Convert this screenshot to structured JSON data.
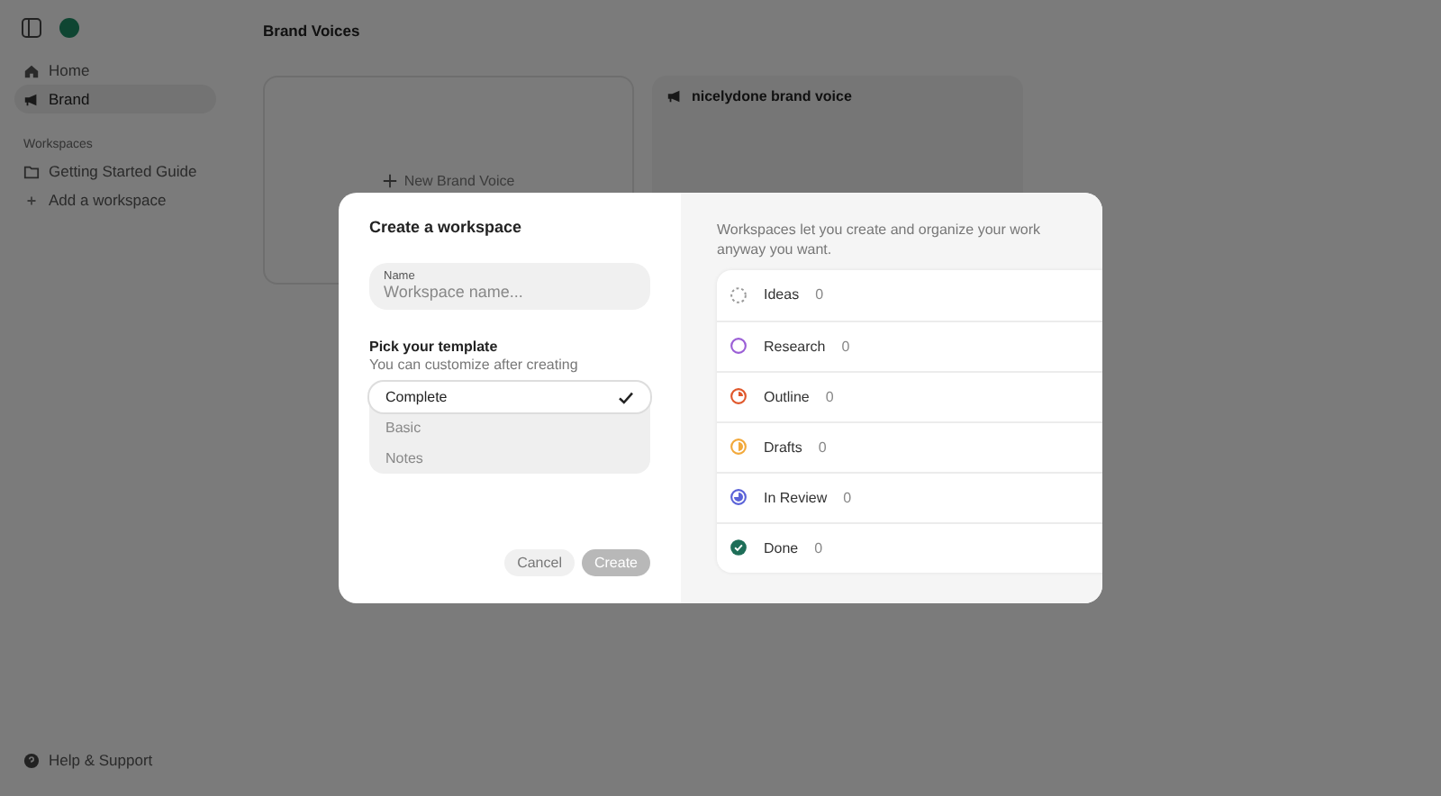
{
  "sidebar": {
    "items": [
      {
        "label": "Home",
        "kind": "home",
        "selected": false
      },
      {
        "label": "Brand",
        "kind": "megaphone",
        "selected": true
      }
    ],
    "section_label": "Workspaces",
    "workspaces": [
      {
        "label": "Getting Started Guide",
        "kind": "folder"
      },
      {
        "label": "Add a workspace",
        "kind": "plus"
      }
    ],
    "footer": "Help & Support"
  },
  "page": {
    "title": "Brand Voices",
    "new_card": "New Brand Voice",
    "cards": [
      {
        "title": "nicelydone brand voice"
      }
    ]
  },
  "dialog": {
    "title": "Create a workspace",
    "name_field": {
      "label": "Name",
      "placeholder": "Workspace name..."
    },
    "template_heading": "Pick your template",
    "template_hint": "You can customize after creating",
    "templates": [
      {
        "label": "Complete",
        "selected": true
      },
      {
        "label": "Basic",
        "selected": false
      },
      {
        "label": "Notes",
        "selected": false
      }
    ],
    "buttons": {
      "cancel": "Cancel",
      "create": "Create",
      "create_disabled": true
    },
    "description": "Workspaces let you create and organize your work anyway you want.",
    "statuses": [
      {
        "label": "Ideas",
        "count": "0",
        "kind": "dashed",
        "color": "#9a9a9a"
      },
      {
        "label": "Research",
        "count": "0",
        "kind": "ring",
        "color": "#9b5fd6"
      },
      {
        "label": "Outline",
        "count": "0",
        "kind": "quarter",
        "color": "#e0582c"
      },
      {
        "label": "Drafts",
        "count": "0",
        "kind": "half",
        "color": "#f2a93b"
      },
      {
        "label": "In Review",
        "count": "0",
        "kind": "most",
        "color": "#5b63d8"
      },
      {
        "label": "Done",
        "count": "0",
        "kind": "done",
        "color": "#1e6e58"
      }
    ]
  }
}
